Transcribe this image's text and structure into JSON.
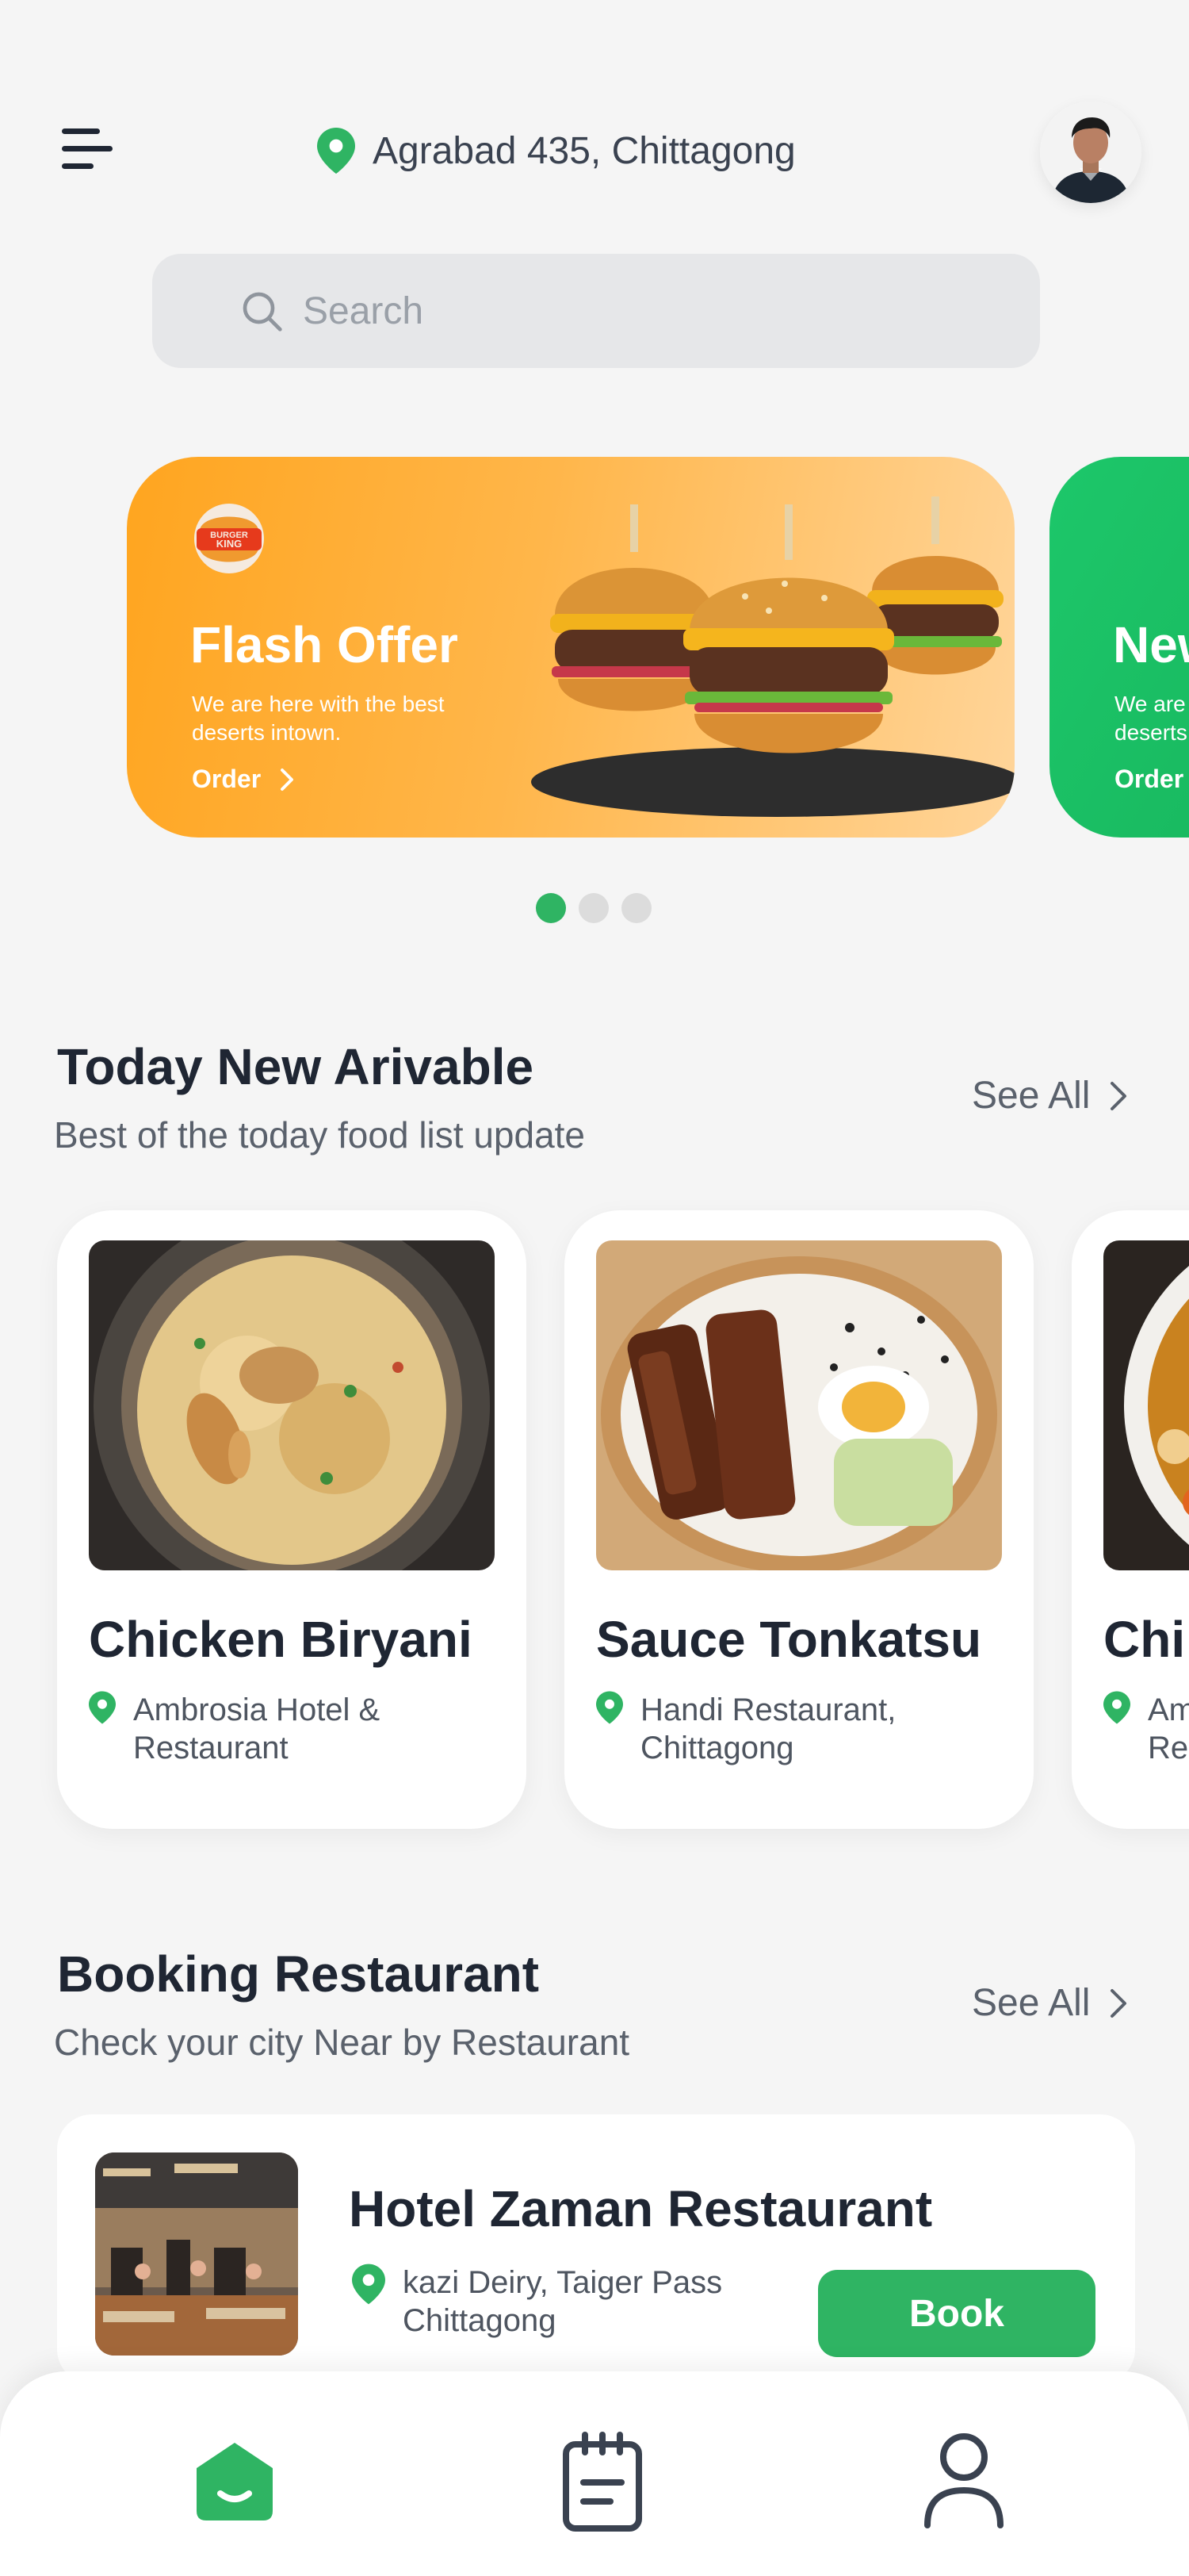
{
  "header": {
    "location": "Agrabad 435, Chittagong"
  },
  "search": {
    "placeholder": "Search"
  },
  "banners": [
    {
      "brand_logo_text": "BURGER KING",
      "title": "Flash Offer",
      "subtitle": "We are here with the best deserts intown.",
      "cta": "Order"
    },
    {
      "title": "New",
      "subtitle": "We are here with the best deserts intown.",
      "cta": "Order"
    }
  ],
  "carousel": {
    "count": 3,
    "active_index": 0
  },
  "today": {
    "title": "Today New Arivable",
    "subtitle": "Best of the today  food list update",
    "see_all": "See All",
    "items": [
      {
        "name": "Chicken Biryani",
        "place": "Ambrosia Hotel & Restaurant"
      },
      {
        "name": "Sauce Tonkatsu",
        "place": "Handi Restaurant, Chittagong"
      },
      {
        "name": "Chi",
        "place": "Am Re"
      }
    ]
  },
  "booking": {
    "title": "Booking Restaurant",
    "subtitle": "Check your city Near by Restaurant",
    "see_all": "See All",
    "restaurant": {
      "name": "Hotel Zaman Restaurant",
      "address": "kazi Deiry, Taiger Pass Chittagong",
      "button": "Book"
    }
  },
  "nav": {
    "items": [
      "home-icon",
      "orders-icon",
      "profile-icon"
    ],
    "active": "home-icon"
  },
  "colors": {
    "accent": "#2fb463",
    "banner_orange": "#ffa51f",
    "banner_green": "#1dc76a",
    "text_dark": "#1f2633",
    "text_muted": "#5a616c"
  }
}
